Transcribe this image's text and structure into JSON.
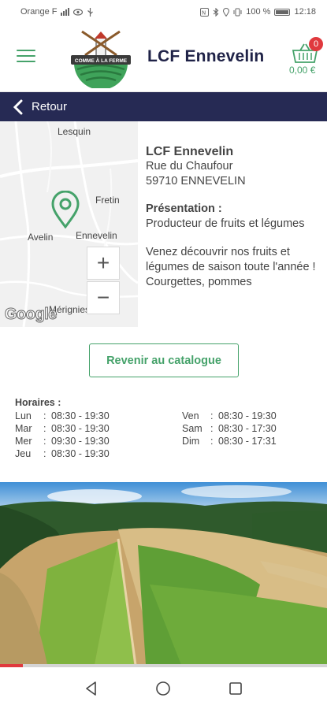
{
  "status_bar": {
    "carrier": "Orange F",
    "battery": "100 %",
    "time": "12:18"
  },
  "header": {
    "logo_text": "COMME À LA FERME",
    "shop_name": "LCF Ennevelin",
    "cart_count": "0",
    "cart_total": "0,00 €"
  },
  "back_bar": {
    "label": "Retour"
  },
  "map": {
    "places": [
      "Lesquin",
      "Fretin",
      "Avelin",
      "Ennevelin",
      "Mérignies"
    ],
    "zoom_in": "+",
    "zoom_out": "−",
    "attribution": "Google"
  },
  "shop": {
    "name": "LCF Ennevelin",
    "street": "Rue du Chaufour",
    "city": "59710 ENNEVELIN",
    "presentation_title": "Présentation :",
    "presentation_text": "Producteur de fruits et légumes",
    "description": "Venez découvrir nos fruits et légumes de saison toute l'année ! Courgettes, pommes"
  },
  "catalog_button": "Revenir au catalogue",
  "hours": {
    "title": "Horaires :",
    "left": [
      {
        "day": "Lun",
        "time": "08:30 - 19:30"
      },
      {
        "day": "Mar",
        "time": "08:30 - 19:30"
      },
      {
        "day": "Mer",
        "time": "09:30 - 19:30"
      },
      {
        "day": "Jeu",
        "time": "08:30 - 19:30"
      }
    ],
    "right": [
      {
        "day": "Ven",
        "time": "08:30 - 19:30"
      },
      {
        "day": "Sam",
        "time": "08:30 - 17:30"
      },
      {
        "day": "Dim",
        "time": "08:30 - 17:31"
      }
    ]
  },
  "colors": {
    "accent_green": "#45a26a",
    "header_navy": "#1f2247",
    "back_bar": "#262a54",
    "badge_red": "#e0393e"
  },
  "carousel_progress": 0.07,
  "icons": [
    "menu-icon",
    "basket-icon",
    "chevron-left-icon",
    "map-pin-icon",
    "nav-back-icon",
    "nav-home-icon",
    "nav-recents-icon"
  ]
}
